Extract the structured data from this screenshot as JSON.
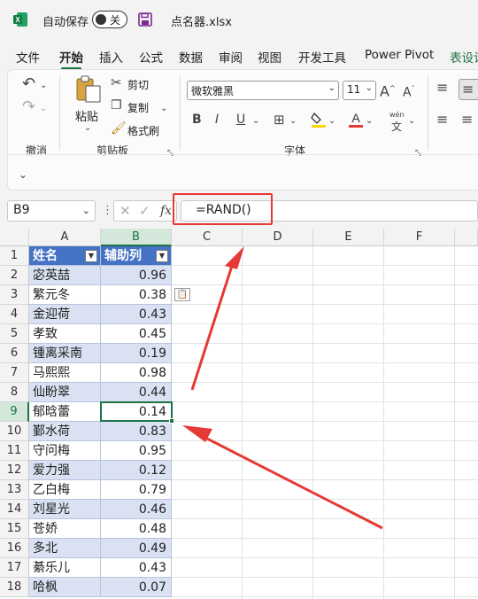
{
  "titlebar": {
    "autosave_label": "自动保存",
    "toggle_state": "关",
    "filename": "点名器.xlsx"
  },
  "tabs": [
    {
      "label": "文件"
    },
    {
      "label": "开始",
      "active": true
    },
    {
      "label": "插入"
    },
    {
      "label": "公式"
    },
    {
      "label": "数据"
    },
    {
      "label": "审阅"
    },
    {
      "label": "视图"
    },
    {
      "label": "开发工具"
    },
    {
      "label": "Power Pivot"
    },
    {
      "label": "表设计"
    }
  ],
  "ribbon": {
    "undo_group_label": "撤消",
    "paste_label": "粘贴",
    "cut_label": "剪切",
    "copy_label": "复制",
    "format_painter_label": "格式刷",
    "clipboard_group_label": "剪贴板",
    "font_name": "微软雅黑",
    "font_size": "11",
    "font_group_label": "字体",
    "bold": "B",
    "italic": "I",
    "underline": "U",
    "wen_label": "wén",
    "wen_char": "文"
  },
  "formula_bar": {
    "name_box": "B9",
    "fx_label": "fx",
    "formula": "=RAND()"
  },
  "columns": [
    "A",
    "B",
    "C",
    "D",
    "E",
    "F"
  ],
  "selected_column": "B",
  "selected_row": "9",
  "table_headers": [
    "姓名",
    "辅助列"
  ],
  "rows": [
    {
      "num": "1"
    },
    {
      "num": "2",
      "name": "宓英喆",
      "value": "0.96"
    },
    {
      "num": "3",
      "name": "繁元冬",
      "value": "0.38"
    },
    {
      "num": "4",
      "name": "金迎荷",
      "value": "0.43"
    },
    {
      "num": "5",
      "name": "孝致",
      "value": "0.45"
    },
    {
      "num": "6",
      "name": "锺离采南",
      "value": "0.19"
    },
    {
      "num": "7",
      "name": "马熙熙",
      "value": "0.98"
    },
    {
      "num": "8",
      "name": "仙盼翠",
      "value": "0.44"
    },
    {
      "num": "9",
      "name": "郁晗蕾",
      "value": "0.14"
    },
    {
      "num": "10",
      "name": "鄞水荷",
      "value": "0.83"
    },
    {
      "num": "11",
      "name": "守问梅",
      "value": "0.95"
    },
    {
      "num": "12",
      "name": "爱力强",
      "value": "0.12"
    },
    {
      "num": "13",
      "name": "乙白梅",
      "value": "0.79"
    },
    {
      "num": "14",
      "name": "刘星光",
      "value": "0.46"
    },
    {
      "num": "15",
      "name": "苍娇",
      "value": "0.48"
    },
    {
      "num": "16",
      "name": "多北",
      "value": "0.49"
    },
    {
      "num": "17",
      "name": "綦乐儿",
      "value": "0.43"
    },
    {
      "num": "18",
      "name": "哈枫",
      "value": "0.07"
    }
  ],
  "colors": {
    "excel_green": "#1e7145",
    "table_header_blue": "#4472c4",
    "table_band": "#d9e1f2",
    "annotation_red": "#e53935"
  }
}
